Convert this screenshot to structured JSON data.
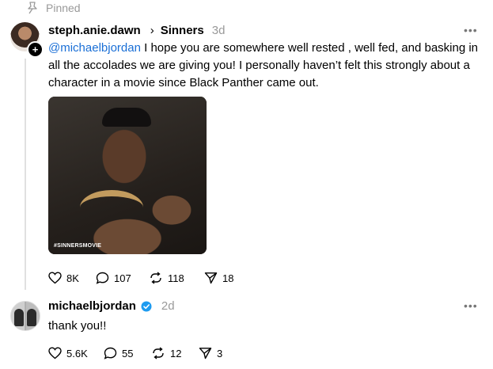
{
  "pinned": {
    "label": "Pinned",
    "icon": "pin-icon"
  },
  "post1": {
    "username": "steph.anie.dawn",
    "community": "Sinners",
    "time": "3d",
    "mention": "@michaelbjordan",
    "text": " I hope you are somewhere well rested , well fed, and basking in all the accolades we are giving you! I personally haven’t felt this strongly about a character in a movie since Black Panther came out.",
    "media_caption": "#SINNERSMOVIE",
    "likes": "8K",
    "replies": "107",
    "reposts": "118",
    "shares": "18"
  },
  "post2": {
    "username": "michaelbjordan",
    "time": "2d",
    "text": "thank you!!",
    "likes": "5.6K",
    "replies": "55",
    "reposts": "12",
    "shares": "3"
  },
  "colors": {
    "mention": "#1a6fd6",
    "muted": "#999999",
    "verified": "#1d9bf0"
  }
}
